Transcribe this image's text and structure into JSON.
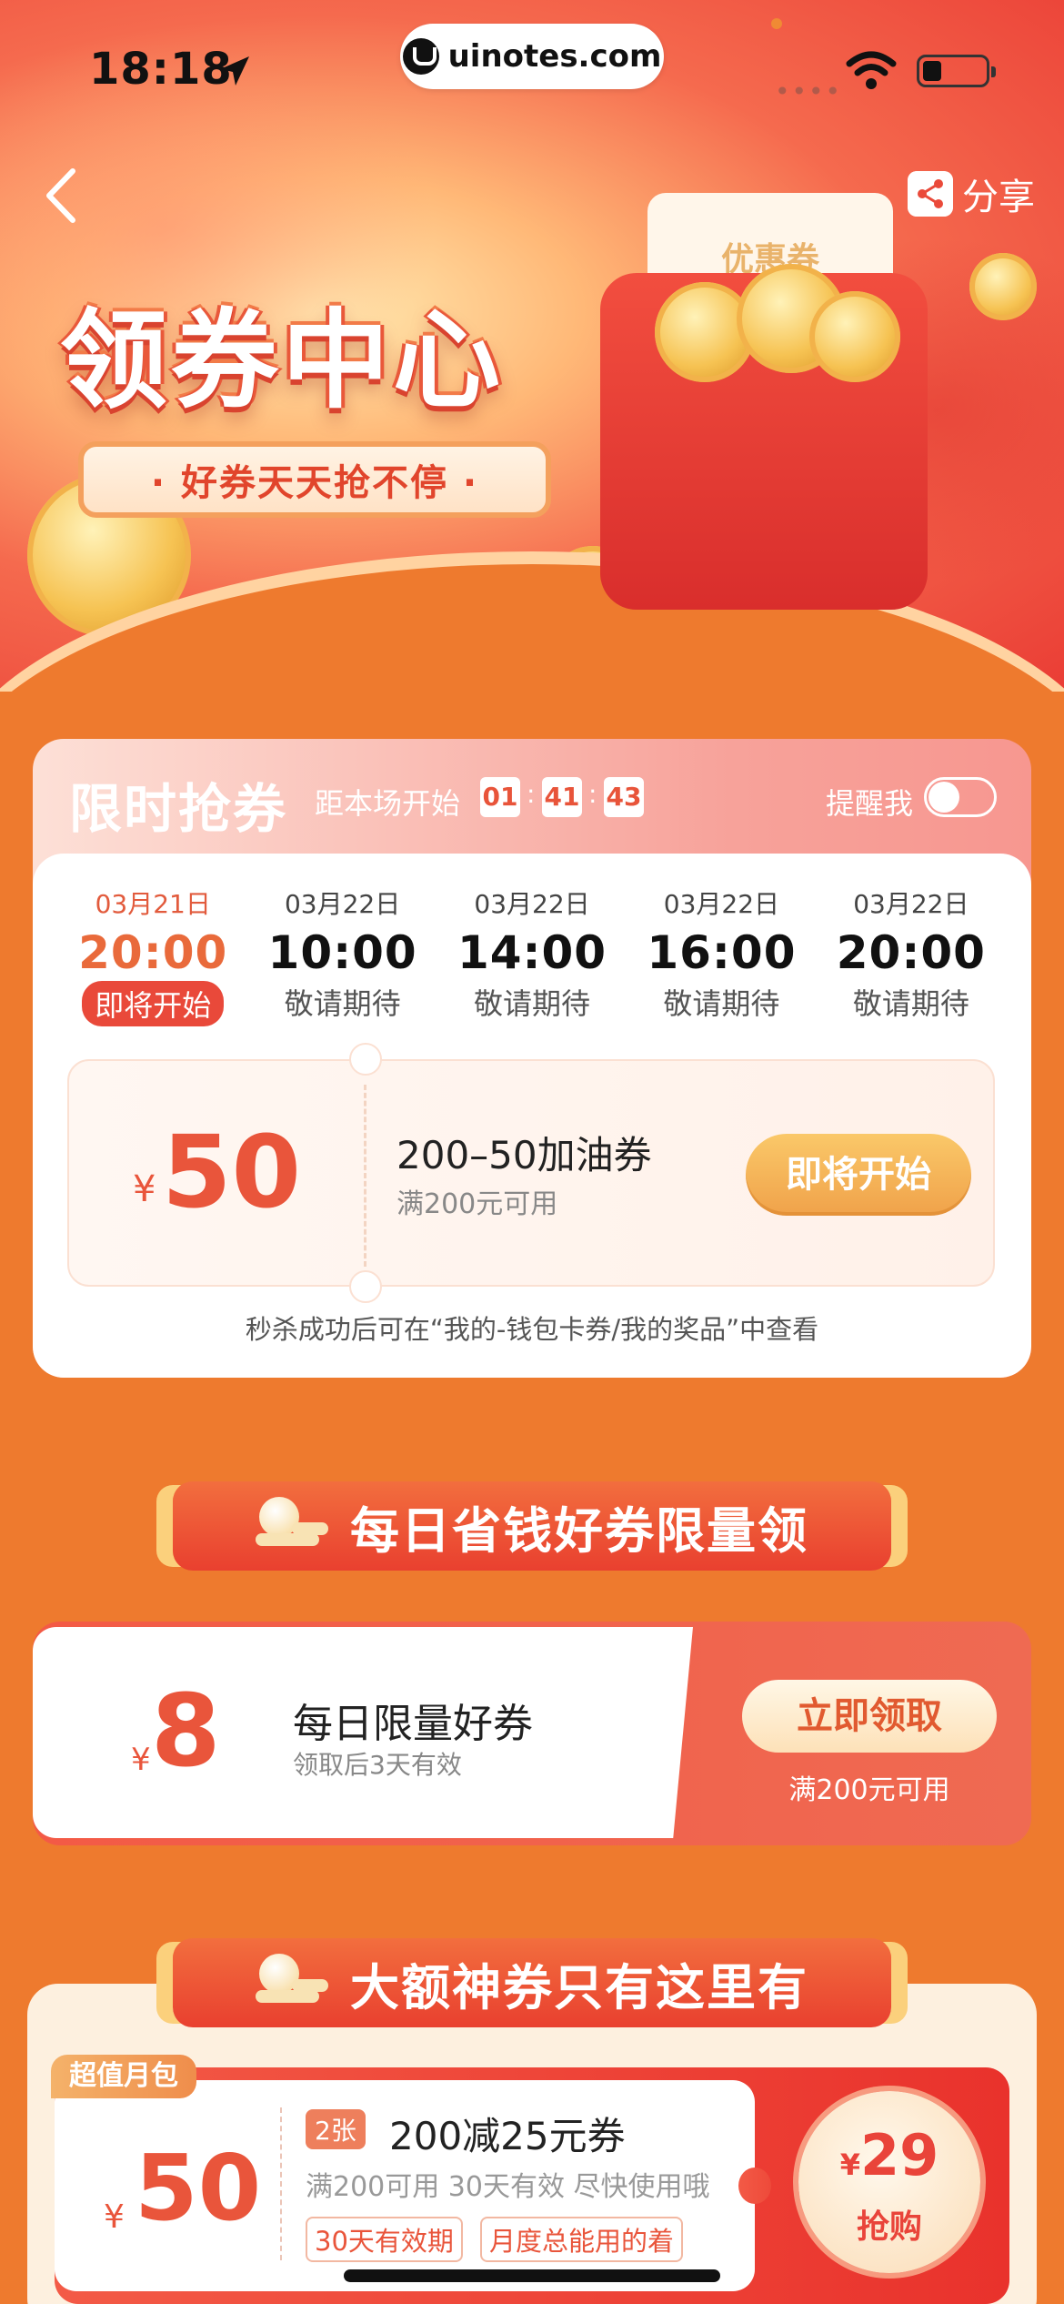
{
  "status_bar": {
    "time": "18:18",
    "url": "uinotes.com"
  },
  "header": {
    "share_label": "分享"
  },
  "hero": {
    "title": "领券中心",
    "subtitle": "· 好券天天抢不停 ·",
    "voucher_label": "优惠券",
    "voucher_symbol": "¥"
  },
  "flash": {
    "title": "限时抢券",
    "countdown_label": "距本场开始",
    "countdown": [
      "01",
      "41",
      "43"
    ],
    "remind_label": "提醒我",
    "remind_on": false,
    "slots": [
      {
        "date": "03月21日",
        "time": "20:00",
        "status": "即将开始"
      },
      {
        "date": "03月22日",
        "time": "10:00",
        "status": "敬请期待"
      },
      {
        "date": "03月22日",
        "time": "14:00",
        "status": "敬请期待"
      },
      {
        "date": "03月22日",
        "time": "16:00",
        "status": "敬请期待"
      },
      {
        "date": "03月22日",
        "time": "20:00",
        "status": "敬请期待"
      }
    ],
    "coupon": {
      "currency": "¥",
      "amount": "50",
      "title": "200–50加油券",
      "condition": "满200元可用",
      "button": "即将开始"
    },
    "note": "秒杀成功后可在“我的-钱包卡券/我的奖品”中查看"
  },
  "daily_section": {
    "title": "每日省钱好券限量领"
  },
  "daily_coupon": {
    "currency": "¥",
    "amount": "8",
    "title": "每日限量好券",
    "validity": "领取后3天有效",
    "button": "立即领取",
    "condition": "满200元可用"
  },
  "big_section": {
    "title": "大额神券只有这里有"
  },
  "big_coupon": {
    "tag": "超值月包",
    "currency": "¥",
    "amount": "50",
    "count": "2张",
    "title": "200减25元券",
    "subtitle": "满200可用 30天有效 尽快使用哦",
    "chips": [
      "30天有效期",
      "月度总能用的着"
    ],
    "price_currency": "¥",
    "price": "29",
    "price_label": "抢购"
  },
  "colors": {
    "accent": "#e9553b",
    "background": "#ee7a2e",
    "button_gold": "#f0a24a"
  }
}
